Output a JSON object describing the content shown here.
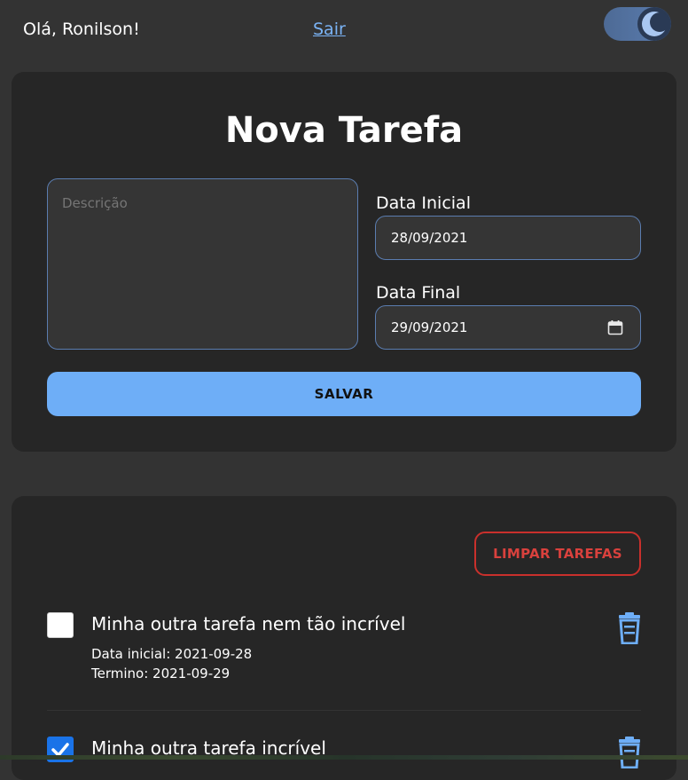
{
  "header": {
    "greeting": "Olá, Ronilson!",
    "logout_label": "Sair",
    "theme_toggle_icon": "moon-icon"
  },
  "form": {
    "title": "Nova Tarefa",
    "description_placeholder": "Descrição",
    "start_label": "Data Inicial",
    "start_value": "28/09/2021",
    "end_label": "Data Final",
    "end_value": "29/09/2021",
    "save_label": "SALVAR"
  },
  "list": {
    "clear_label": "LIMPAR TAREFAS",
    "tasks": [
      {
        "title": "Minha outra tarefa nem tão incrível",
        "start": "Data inicial: 2021-09-28",
        "end": "Termino: 2021-09-29",
        "done": false
      },
      {
        "title": "Minha outra tarefa incrível",
        "done": true
      }
    ]
  },
  "colors": {
    "accent": "#6eaef7",
    "danger": "#c9302c",
    "card": "#262626",
    "background": "#333333"
  }
}
